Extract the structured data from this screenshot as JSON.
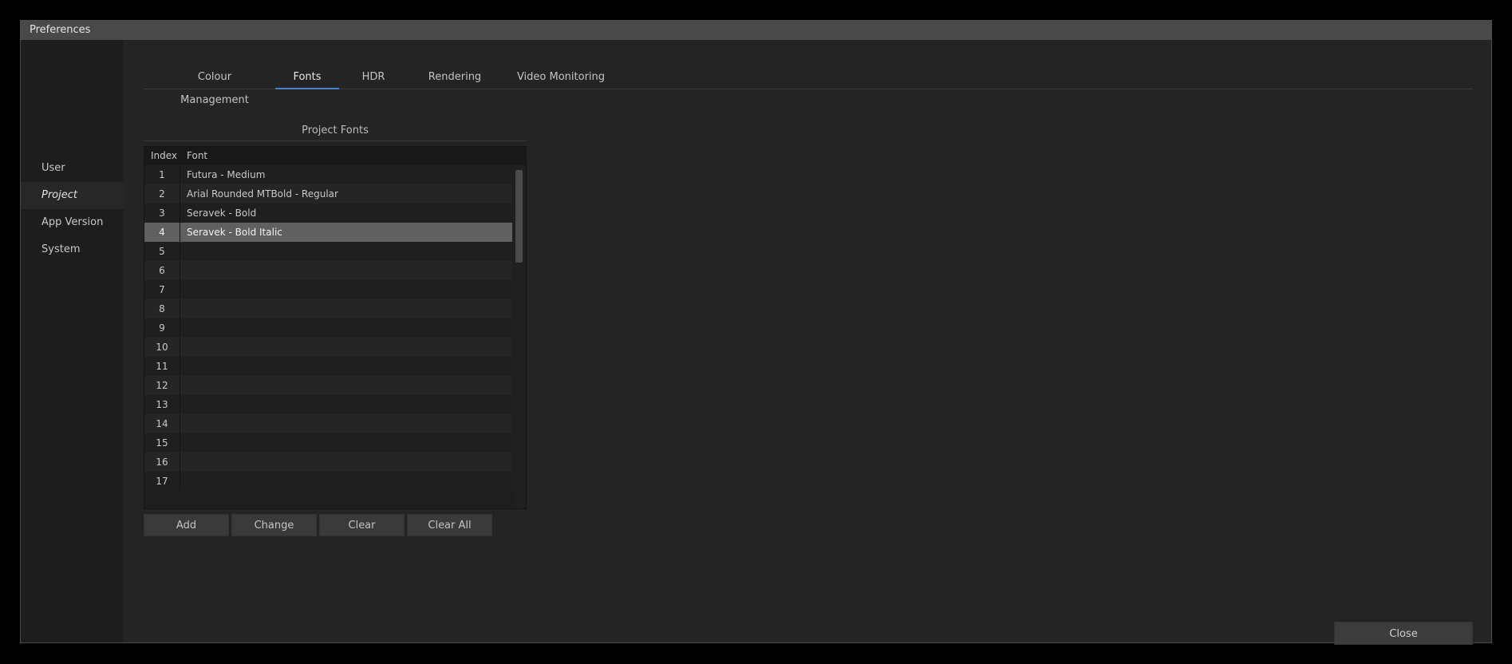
{
  "window": {
    "title": "Preferences"
  },
  "sidebar": {
    "items": [
      {
        "label": "User"
      },
      {
        "label": "Project"
      },
      {
        "label": "App Version"
      },
      {
        "label": "System"
      }
    ]
  },
  "tabs": [
    {
      "label": "Colour Management"
    },
    {
      "label": "Fonts"
    },
    {
      "label": "HDR"
    },
    {
      "label": "Rendering"
    },
    {
      "label": "Video Monitoring"
    }
  ],
  "fonts_panel": {
    "group_label": "Project Fonts",
    "columns": {
      "index": "Index",
      "font": "Font"
    },
    "rows": [
      {
        "index": "1",
        "font": "Futura - Medium"
      },
      {
        "index": "2",
        "font": "Arial Rounded MTBold - Regular"
      },
      {
        "index": "3",
        "font": "Seravek - Bold"
      },
      {
        "index": "4",
        "font": "Seravek - Bold Italic"
      },
      {
        "index": "5",
        "font": ""
      },
      {
        "index": "6",
        "font": ""
      },
      {
        "index": "7",
        "font": ""
      },
      {
        "index": "8",
        "font": ""
      },
      {
        "index": "9",
        "font": ""
      },
      {
        "index": "10",
        "font": ""
      },
      {
        "index": "11",
        "font": ""
      },
      {
        "index": "12",
        "font": ""
      },
      {
        "index": "13",
        "font": ""
      },
      {
        "index": "14",
        "font": ""
      },
      {
        "index": "15",
        "font": ""
      },
      {
        "index": "16",
        "font": ""
      },
      {
        "index": "17",
        "font": ""
      }
    ],
    "buttons": {
      "add": "Add",
      "change": "Change",
      "clear": "Clear",
      "clear_all": "Clear All"
    }
  },
  "footer": {
    "close_label": "Close"
  }
}
